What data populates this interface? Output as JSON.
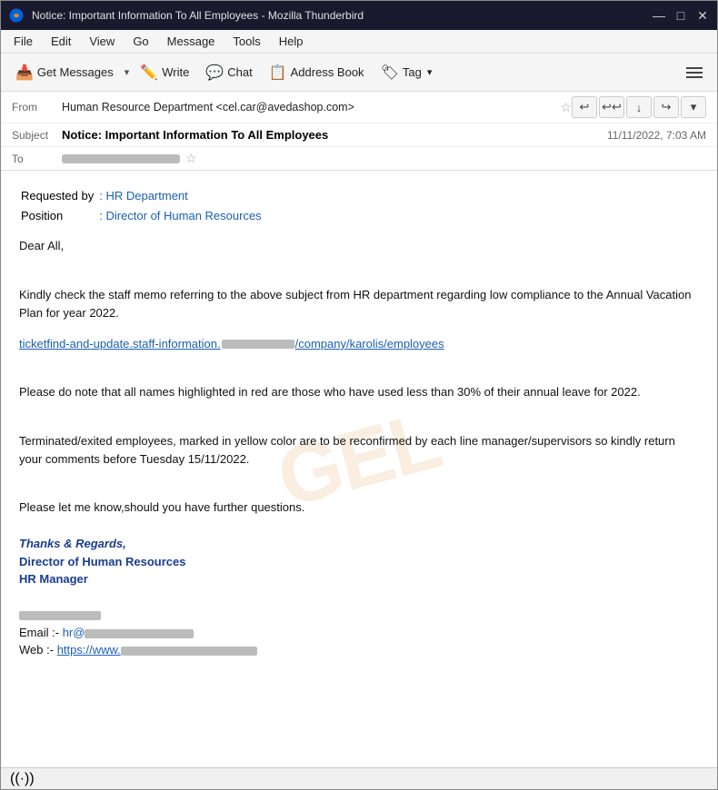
{
  "window": {
    "title": "Notice: Important Information To All Employees - Mozilla Thunderbird"
  },
  "title_bar": {
    "title": "Notice: Important Information To All Employees - Mozilla Thunderbird",
    "minimize": "—",
    "maximize": "□",
    "close": "✕"
  },
  "menu_bar": {
    "items": [
      "File",
      "Edit",
      "View",
      "Go",
      "Message",
      "Tools",
      "Help"
    ]
  },
  "toolbar": {
    "get_messages": "Get Messages",
    "write": "Write",
    "chat": "Chat",
    "address_book": "Address Book",
    "tag": "Tag"
  },
  "email_header": {
    "from_label": "From",
    "from_value": "Human Resource Department <cel.car@avedashop.com>",
    "subject_label": "Subject",
    "subject_value": "Notice: Important Information To All Employees",
    "to_label": "To",
    "timestamp": "11/11/2022, 7:03 AM"
  },
  "email_body": {
    "requested_by_label": "Requested by",
    "requested_by_value": ": HR Department",
    "position_label": "Position",
    "position_value": ": Director of Human Resources",
    "greeting": "Dear All,",
    "para1": "Kindly check the staff memo referring to the above subject from HR department regarding low compliance to the Annual Vacation Plan for year 2022.",
    "link_prefix": "ticketfind-and-update.staff-information.",
    "link_suffix": "/company/karolis/employees",
    "para2": "Please do note that all names highlighted in red are those who have used less than 30% of their annual leave for 2022.",
    "para3": "Terminated/exited employees, marked in yellow color are to be reconfirmed by each line manager/supervisors so kindly return your comments before Tuesday 15/11/2022.",
    "para4": "Please let me know,should you have further questions.",
    "sig_thanks": "Thanks & Regards,",
    "sig_director": "Director of Human Resources",
    "sig_hr": "HR Manager",
    "sig_email_prefix": "Email :-",
    "sig_email_value": "hr@",
    "sig_web_prefix": "Web   :-",
    "sig_web_value": "https://www."
  },
  "watermark": {
    "text": "GEL"
  },
  "status_bar": {
    "icon": "((·))"
  }
}
